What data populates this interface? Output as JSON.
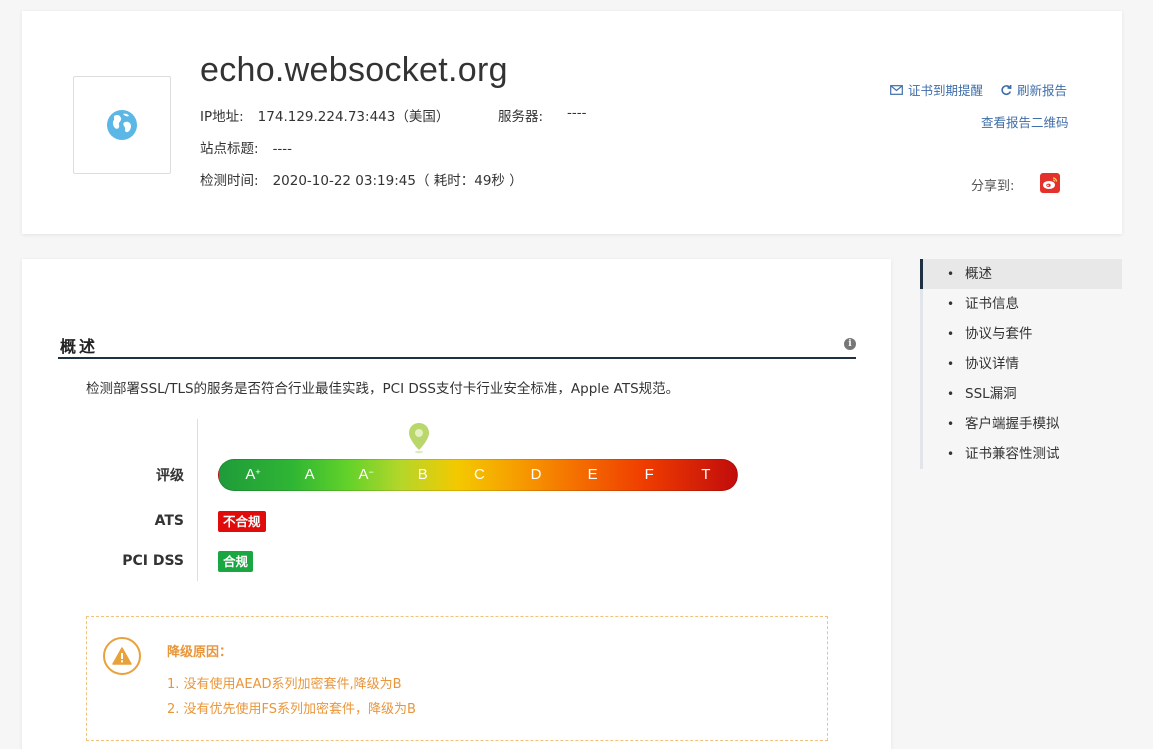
{
  "header": {
    "domain": "echo.websocket.org",
    "ip_label": "IP地址:",
    "ip_value": "174.129.224.73:443（美国）",
    "server_label": "服务器:",
    "server_value": "----",
    "site_title_label": "站点标题:",
    "site_title_value": "----",
    "check_time_label": "检测时间:",
    "check_time_value": "2020-10-22 03:19:45（ 耗时：49秒 ）",
    "actions": {
      "expiry_reminder": "证书到期提醒",
      "refresh_report": "刷新报告",
      "view_qr": "查看报告二维码"
    },
    "share_label": "分享到:",
    "icons": {
      "site": "globe-icon",
      "expiry": "envelope-icon",
      "refresh": "refresh-icon",
      "share": "weibo-icon"
    }
  },
  "overview": {
    "title": "概述",
    "description": "检测部署SSL/TLS的服务是否符合行业最佳实践，PCI DSS支付卡行业安全标准，Apple ATS规范。",
    "rating_label": "评级",
    "grades": [
      "A+",
      "A",
      "A-",
      "B",
      "C",
      "D",
      "E",
      "F",
      "T"
    ],
    "current_grade": "B",
    "ats_label": "ATS",
    "ats_status": "不合规",
    "pci_label": "PCI DSS",
    "pci_status": "合规",
    "status_colors": {
      "fail": "#e00b0b",
      "pass": "#1aa640",
      "warning": "#e9963a"
    },
    "downgrade": {
      "title": "降级原因：",
      "reasons": [
        "1. 没有使用AEAD系列加密套件,降级为B",
        "2. 没有优先使用FS系列加密套件，降级为B"
      ]
    }
  },
  "side_nav": {
    "items": [
      "概述",
      "证书信息",
      "协议与套件",
      "协议详情",
      "SSL漏洞",
      "客户端握手模拟",
      "证书兼容性测试"
    ],
    "active": "概述"
  }
}
